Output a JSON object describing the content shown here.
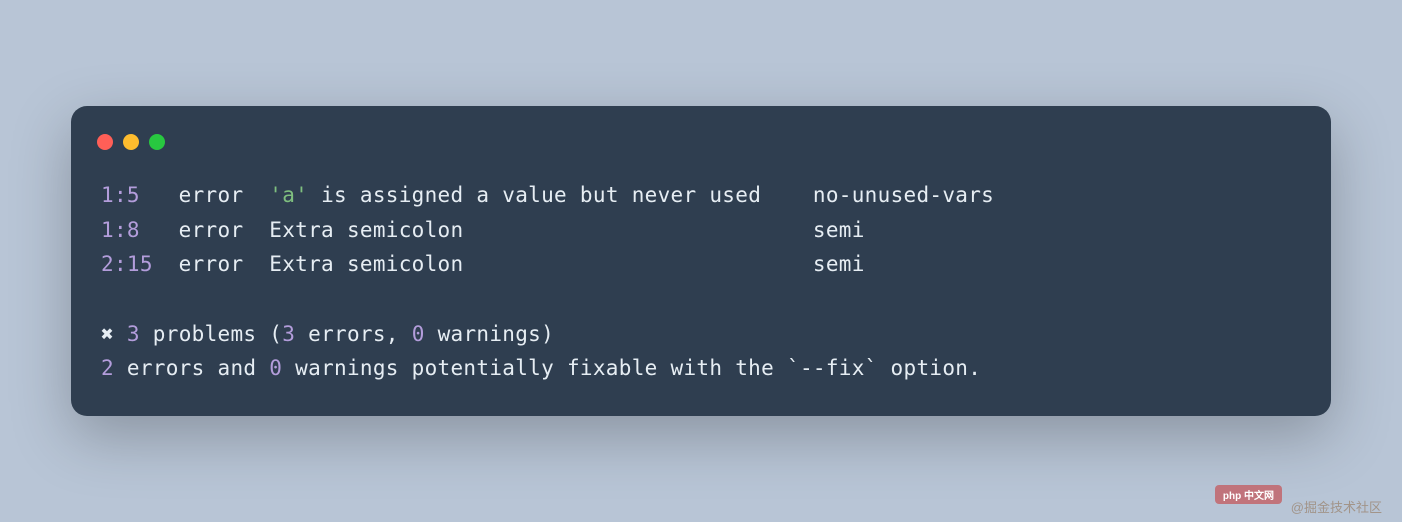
{
  "traffic": {
    "close": "#ff5f57",
    "min": "#febc2e",
    "max": "#28c840"
  },
  "errors": [
    {
      "loc": "1:5",
      "severity": "error",
      "quoted": "'a'",
      "message": " is assigned a value but never used",
      "rule": "no-unused-vars"
    },
    {
      "loc": "1:8",
      "severity": "error",
      "quoted": "",
      "message": "Extra semicolon",
      "rule": "semi"
    },
    {
      "loc": "2:15",
      "severity": "error",
      "quoted": "",
      "message": "Extra semicolon",
      "rule": "semi"
    }
  ],
  "summary": {
    "cross": "✖",
    "problemsCount": "3",
    "problemsLabel": " problems (",
    "errorsCount": "3",
    "errorsLabel": " errors, ",
    "warningsCount": "0",
    "warningsLabel": " warnings)"
  },
  "fixable": {
    "fixErrors": "2",
    "mid1": " errors and ",
    "fixWarnings": "0",
    "mid2": " warnings potentially fixable with the `--fix` option."
  },
  "watermark": "@掘金技术社区",
  "pill": "php 中文网"
}
